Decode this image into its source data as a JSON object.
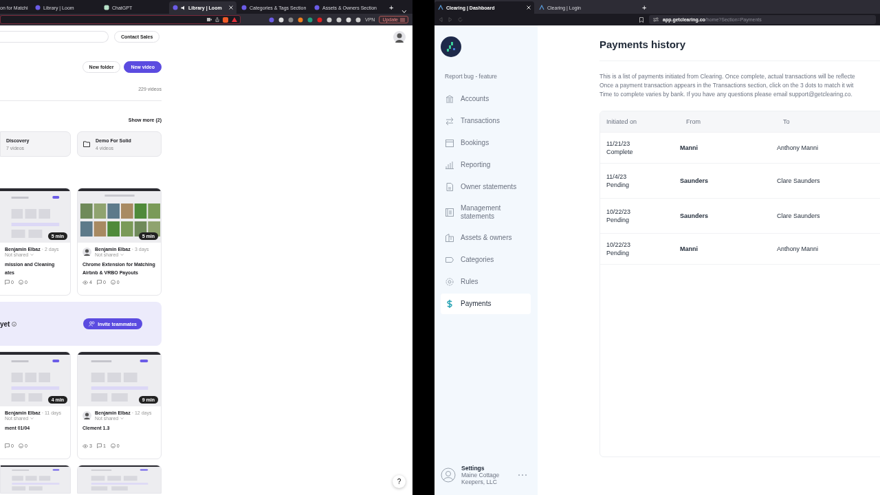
{
  "left_browser": {
    "tabs": [
      {
        "title": "on for Matchi",
        "selected": false
      },
      {
        "title": "Library | Loom",
        "selected": false
      },
      {
        "title": "ChatGPT",
        "selected": false
      },
      {
        "title": "Library | Loom",
        "selected": true
      },
      {
        "title": "Categories & Tags Section",
        "selected": false
      },
      {
        "title": "Assets & Owners Section",
        "selected": false
      }
    ],
    "new_tab": "+",
    "vpn": "VPN",
    "update": "Update"
  },
  "loom": {
    "contact_sales": "Contact Sales",
    "new_folder": "New folder",
    "new_video": "New video",
    "video_count": "229 videos",
    "show_more": "Show more (2)",
    "folders": [
      {
        "name": "Discovery",
        "count": "7 videos"
      },
      {
        "name": "Demo For Solid",
        "count": "4 videos"
      }
    ],
    "video_rows": [
      [
        {
          "author": "Benjamin Elbaz",
          "age": "· 2 days",
          "sharing": "Not shared",
          "duration": "5 min",
          "title_lines": [
            "mission and Cleaning",
            "ates"
          ],
          "comments": "0",
          "reactions": "0"
        },
        {
          "avatar": true,
          "author": "Benjamin Elbaz",
          "age": "· 3 days",
          "sharing": "Not shared",
          "duration": "5 min",
          "title_lines": [
            "Chrome Extension for Matching",
            "Airbnb & VRBO Payouts"
          ],
          "views": "4",
          "comments": "0",
          "reactions": "0"
        }
      ],
      [
        {
          "author": "Benjamin Elbaz",
          "age": "· 11 days",
          "sharing": "Not shared",
          "duration": "4 min",
          "title_lines": [
            "ment 01/04"
          ],
          "comments": "0",
          "reactions": "0"
        },
        {
          "avatar": true,
          "author": "Benjamin Elbaz",
          "age": "· 12 days",
          "sharing": "Not shared",
          "duration": "9 min",
          "title_lines": [
            "Clement 1.3"
          ],
          "views": "3",
          "comments": "1",
          "reactions": "0"
        }
      ]
    ],
    "banner": {
      "text": "yet",
      "button": "Invite teammates"
    },
    "help": "?"
  },
  "clearing_browser": {
    "tabs": [
      {
        "title": "Clearing | Dashboard",
        "selected": true
      },
      {
        "title": "Clearing | Login",
        "selected": false
      }
    ],
    "new_tab": "+",
    "url_host": "app.getclearing.co",
    "url_path": "/home?Section=Payments"
  },
  "sidebar": {
    "report": "Report bug - feature",
    "items": [
      {
        "label": "Accounts",
        "selected": false
      },
      {
        "label": "Transactions",
        "selected": false
      },
      {
        "label": "Bookings",
        "selected": false
      },
      {
        "label": "Reporting",
        "selected": false
      },
      {
        "label": "Owner statements",
        "selected": false
      },
      {
        "label": "Management statements",
        "selected": false
      },
      {
        "label": "Assets & owners",
        "selected": false
      },
      {
        "label": "Categories",
        "selected": false
      },
      {
        "label": "Rules",
        "selected": false
      },
      {
        "label": "Payments",
        "selected": true
      }
    ],
    "settings": {
      "title": "Settings",
      "org": "Maine Cottage Keepers, LLC"
    }
  },
  "main": {
    "title": "Payments history",
    "description": [
      "This is a list of payments initiated from Clearing. Once complete, actual transactions will be reflecte",
      "Once a payment transaction appears in the Transactions section, click on the 3 dots to match it wit",
      "Time to complete varies by bank. If you have any questions please email support@getclearing.co."
    ],
    "table": {
      "columns": [
        "Initiated on",
        "From",
        "To"
      ],
      "rows": [
        {
          "date": "11/21/23",
          "status": "Complete",
          "from": "Manni",
          "to": "Anthony Manni"
        },
        {
          "date": "11/4/23",
          "status": "Pending",
          "from": "Saunders",
          "to": "Clare Saunders"
        },
        {
          "date": "10/22/23",
          "status": "Pending",
          "from": "Saunders",
          "to": "Clare Saunders"
        },
        {
          "date": "10/22/23",
          "status": "Pending",
          "from": "Manni",
          "to": "Anthony Manni"
        }
      ]
    }
  }
}
